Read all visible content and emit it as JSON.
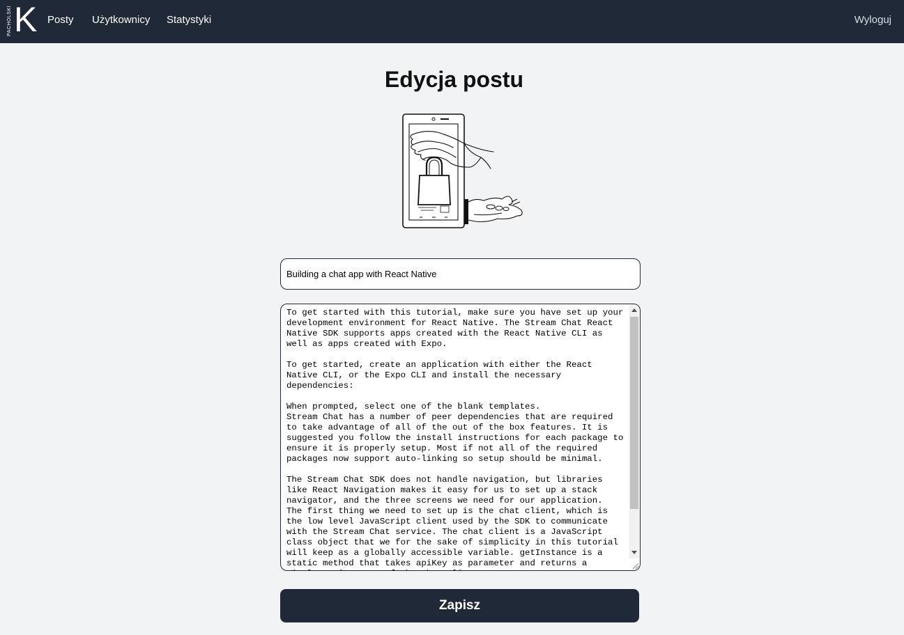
{
  "navbar": {
    "logo_small": "PACHOLSKI",
    "logo_big": "K",
    "links": [
      "Posty",
      "Użytkownicy",
      "Statystyki"
    ],
    "logout": "Wyloguj"
  },
  "page": {
    "title": "Edycja postu"
  },
  "form": {
    "title_value": "Building a chat app with React Native",
    "content_value": "To get started with this tutorial, make sure you have set up your\ndevelopment environment for React Native. The Stream Chat React\nNative SDK supports apps created with the React Native CLI as\nwell as apps created with Expo.\n\nTo get started, create an application with either the React\nNative CLI, or the Expo CLI and install the necessary\ndependencies:\n\nWhen prompted, select one of the blank templates.\nStream Chat has a number of peer dependencies that are required\nto take advantage of all of the out of the box features. It is\nsuggested you follow the install instructions for each package to\nensure it is properly setup. Most if not all of the required\npackages now support auto-linking so setup should be minimal.\n\nThe Stream Chat SDK does not handle navigation, but libraries\nlike React Navigation makes it easy for us to set up a stack\nnavigator, and the three screens we need for our application.\nThe first thing we need to set up is the chat client, which is\nthe low level JavaScript client used by the SDK to communicate\nwith the Stream Chat service. The chat client is a JavaScript\nclass object that we for the sake of simplicity in this tutorial\nwill keep as a globally accessible variable. getInstance is a\nstatic method that takes apiKey as parameter and returns a\nsingleton instance of the chat client.",
    "save_label": "Zapisz"
  },
  "colors": {
    "navbar_bg": "#1f2937",
    "page_bg": "#f2f3f5",
    "button_bg": "#1f2937"
  }
}
